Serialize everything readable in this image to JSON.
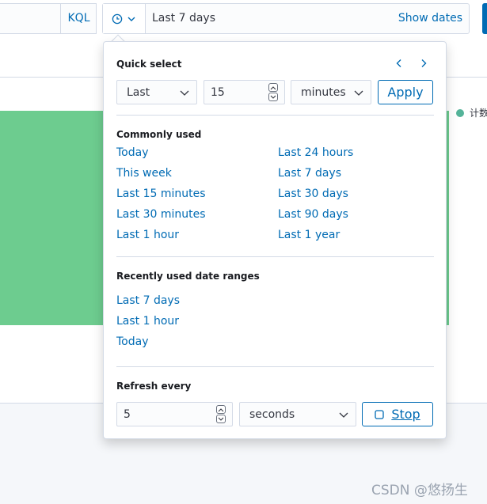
{
  "query_bar": {
    "language_button": "KQL"
  },
  "date_picker": {
    "current_range": "Last 7 days",
    "show_dates": "Show dates"
  },
  "chart_legend": {
    "label": "计数"
  },
  "quick_select": {
    "title": "Quick select",
    "direction": "Last",
    "value": "15",
    "unit": "minutes",
    "apply_label": "Apply"
  },
  "commonly_used": {
    "title": "Commonly used",
    "left": [
      "Today",
      "This week",
      "Last 15 minutes",
      "Last 30 minutes",
      "Last 1 hour"
    ],
    "right": [
      "Last 24 hours",
      "Last 7 days",
      "Last 30 days",
      "Last 90 days",
      "Last 1 year"
    ]
  },
  "recently_used": {
    "title": "Recently used date ranges",
    "items": [
      "Last 7 days",
      "Last 1 hour",
      "Today"
    ]
  },
  "refresh": {
    "title": "Refresh every",
    "value": "5",
    "unit": "seconds",
    "stop_label": "Stop"
  },
  "watermark": "CSDN @悠扬生",
  "colors": {
    "accent": "#006bb4",
    "chart_fill": "#6dcc8f",
    "legend_dot": "#54b399",
    "border": "#d3dae6"
  },
  "icons": [
    "clock-icon",
    "chevron-down-icon",
    "arrow-left-icon",
    "arrow-right-icon",
    "stop-icon"
  ]
}
